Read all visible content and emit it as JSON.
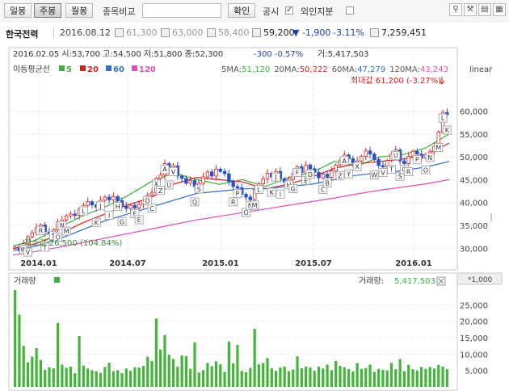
{
  "toolbar": {
    "tabs": [
      "일봉",
      "주봉",
      "월봉"
    ],
    "compare_label": "종목비교",
    "confirm_label": "확인",
    "disclosure_label": "공시",
    "foreign_label": "외인지분",
    "icons": [
      "magic-wand-icon",
      "tools-icon",
      "save-icon",
      "layout-icon"
    ]
  },
  "info": {
    "stock_name": "한국전력",
    "date": "2016.08.12",
    "open_icon": "시",
    "open": "61,300",
    "high_icon": "고",
    "high": "63,000",
    "low_icon": "저",
    "low": "58,400",
    "close_icon": "종",
    "close": "59,200",
    "change": "▼ -1,900",
    "change_pct": "-3.11%",
    "vol_icon": "거",
    "volume": "7,259,451"
  },
  "chart_header": {
    "line1": "2016.02.05  시:53,700  고:54,500  저:51,800  종:52,300",
    "chg": "-300  -0.57%",
    "vol": "거:5,417,503",
    "ma_title": "이동평균선",
    "ma_legend": [
      {
        "label": "5",
        "color": "#3cb23c"
      },
      {
        "label": "20",
        "color": "#d9201a"
      },
      {
        "label": "60",
        "color": "#2f6fd1"
      },
      {
        "label": "120",
        "color": "#e04fb5"
      }
    ],
    "ma_values": [
      {
        "label": "5MA:",
        "value": "51,120",
        "color": "#3cb23c"
      },
      {
        "label": "20MA:",
        "value": "50,222",
        "color": "#d9201a"
      },
      {
        "label": "60MA:",
        "value": "47,279",
        "color": "#2f6fd1"
      },
      {
        "label": "120MA:",
        "value": "43,243",
        "color": "#e04fb5"
      }
    ],
    "scale": "linear",
    "max_label": "최대값 61,200 (-3.27%)",
    "min_label": "최소값 26,500 (104.84%)"
  },
  "volume_header": {
    "title": "거래량",
    "label": "거래량:",
    "value": "5,417,503",
    "unit": "*1,000"
  },
  "chart_data": {
    "type": "candlestick",
    "x_ticks": [
      "2014.01",
      "2014.07",
      "2015.01",
      "2015.07",
      "2016.01"
    ],
    "price_ticks": [
      30000,
      35000,
      40000,
      45000,
      50000,
      55000,
      60000
    ],
    "price_range": [
      26000,
      64500
    ],
    "volume_ticks": [
      5000,
      10000,
      15000,
      20000,
      25000
    ],
    "volume_range": [
      0,
      30000
    ],
    "closes": [
      30200,
      29500,
      31000,
      32500,
      33400,
      34500,
      35100,
      33600,
      33200,
      34000,
      35800,
      36200,
      37100,
      37500,
      37200,
      38600,
      39400,
      40200,
      39500,
      39000,
      40500,
      41200,
      40600,
      41300,
      40400,
      39200,
      38700,
      39400,
      38800,
      39600,
      40500,
      41600,
      42100,
      45300,
      46000,
      48500,
      47200,
      48000,
      45800,
      45300,
      44200,
      44800,
      43500,
      44200,
      45600,
      46700,
      45800,
      47300,
      46800,
      46300,
      44600,
      43500,
      43200,
      41800,
      41200,
      40600,
      42800,
      44100,
      45200,
      46400,
      45600,
      46800,
      45200,
      44500,
      45100,
      46400,
      47800,
      46500,
      48200,
      47400,
      46600,
      45400,
      46200,
      45500,
      46900,
      48200,
      49200,
      50400,
      49600,
      48600,
      49100,
      50100,
      51300,
      50600,
      49400,
      48100,
      47800,
      49200,
      50600,
      51500,
      49100,
      48500,
      50100,
      51200,
      50600,
      49700,
      50500,
      51100,
      52300,
      55400,
      59700,
      59200
    ],
    "volumes": [
      29500,
      22000,
      12500,
      7500,
      9200,
      11800,
      8200,
      5200,
      6000,
      5700,
      19500,
      6800,
      5800,
      6200,
      4200,
      15500,
      6500,
      5600,
      5100,
      4800,
      4300,
      6100,
      7400,
      4800,
      5100,
      4200,
      5600,
      4900,
      6000,
      5900,
      6400,
      9200,
      7900,
      20800,
      11400,
      15800,
      9800,
      8500,
      6200,
      9600,
      9400,
      5500,
      13600,
      4400,
      5100,
      7300,
      6300,
      7800,
      6900,
      4600,
      13800,
      7200,
      12800,
      4900,
      4500,
      5800,
      17700,
      6900,
      7300,
      8800,
      5700,
      4900,
      5900,
      6200,
      4800,
      5300,
      9300,
      5700,
      6200,
      5900,
      4900,
      6200,
      5600,
      6800,
      5100,
      7900,
      6400,
      6000,
      5400,
      4700,
      7300,
      5500,
      5800,
      6800,
      4600,
      5500,
      5200,
      5000,
      7300,
      5400,
      8500,
      4800,
      6700,
      5400,
      5000,
      6100,
      5500,
      6100,
      5600,
      6700,
      6200,
      5400
    ],
    "ma_series": [
      {
        "name": "5",
        "color": "#3cb23c",
        "points": [
          30500,
          31800,
          34500,
          37000,
          39000,
          41500,
          44500,
          46500,
          45000,
          44000,
          45000,
          43500,
          45500,
          46500,
          49000,
          48000,
          50000,
          50500,
          52000,
          55000
        ]
      },
      {
        "name": "20",
        "color": "#d9201a",
        "points": [
          30000,
          31000,
          33000,
          35500,
          37500,
          39500,
          41000,
          44000,
          45500,
          45000,
          44500,
          43000,
          44000,
          45500,
          47500,
          48500,
          49000,
          49500,
          50500,
          53000
        ]
      },
      {
        "name": "60",
        "color": "#2f6fd1",
        "points": [
          29500,
          30500,
          32000,
          34000,
          36000,
          37500,
          39000,
          40500,
          42000,
          42500,
          43000,
          43000,
          43500,
          44000,
          45000,
          46000,
          46500,
          47000,
          47800,
          49000
        ]
      },
      {
        "name": "120",
        "color": "#e04fb5",
        "points": [
          28500,
          29300,
          30200,
          31200,
          32200,
          33200,
          34200,
          35200,
          36200,
          37000,
          37800,
          38600,
          39400,
          40200,
          41000,
          41900,
          42700,
          43400,
          44100,
          45000
        ]
      }
    ],
    "markers": [
      {
        "i": 2,
        "l": "W",
        "up": false
      },
      {
        "i": 3,
        "l": "V",
        "up": false
      },
      {
        "i": 6,
        "l": "R",
        "up": false
      },
      {
        "i": 7,
        "l": "T",
        "up": false
      },
      {
        "i": 9,
        "l": "S",
        "up": false
      },
      {
        "i": 10,
        "l": "O",
        "up": false
      },
      {
        "i": 11,
        "l": "N",
        "up": false
      },
      {
        "i": 12,
        "l": "M",
        "up": false
      },
      {
        "i": 16,
        "l": "L",
        "up": false
      },
      {
        "i": 19,
        "l": "K",
        "up": false
      },
      {
        "i": 20,
        "l": "J",
        "up": false
      },
      {
        "i": 22,
        "l": "I",
        "up": false
      },
      {
        "i": 24,
        "l": "H",
        "up": false
      },
      {
        "i": 25,
        "l": "G",
        "up": false
      },
      {
        "i": 28,
        "l": "F",
        "up": false
      },
      {
        "i": 29,
        "l": "E",
        "up": false
      },
      {
        "i": 31,
        "l": "D",
        "up": false
      },
      {
        "i": 32,
        "l": "C",
        "up": false
      },
      {
        "i": 33,
        "l": "X",
        "up": false
      },
      {
        "i": 34,
        "l": "Z",
        "up": false
      },
      {
        "i": 35,
        "l": "A",
        "up": false
      },
      {
        "i": 36,
        "l": "U",
        "up": false
      },
      {
        "i": 37,
        "l": "V",
        "up": false
      },
      {
        "i": 42,
        "l": "Q",
        "up": false
      },
      {
        "i": 43,
        "l": "S",
        "up": false
      },
      {
        "i": 51,
        "l": "R",
        "up": false
      },
      {
        "i": 52,
        "l": "P",
        "up": false
      },
      {
        "i": 54,
        "l": "O",
        "up": false
      },
      {
        "i": 55,
        "l": "N",
        "up": false
      },
      {
        "i": 56,
        "l": "M",
        "up": false
      },
      {
        "i": 57,
        "l": "L",
        "up": false
      },
      {
        "i": 60,
        "l": "K",
        "up": false
      },
      {
        "i": 61,
        "l": "J",
        "up": false
      },
      {
        "i": 62,
        "l": "I",
        "up": false
      },
      {
        "i": 64,
        "l": "H",
        "up": false
      },
      {
        "i": 65,
        "l": "G",
        "up": false
      },
      {
        "i": 66,
        "l": "F",
        "up": false
      },
      {
        "i": 68,
        "l": "E",
        "up": false
      },
      {
        "i": 69,
        "l": "D",
        "up": false
      },
      {
        "i": 72,
        "l": "C",
        "up": false
      },
      {
        "i": 73,
        "l": "B",
        "up": false
      },
      {
        "i": 76,
        "l": "Z",
        "up": false
      },
      {
        "i": 77,
        "l": "A",
        "up": false
      },
      {
        "i": 78,
        "l": "Y",
        "up": false
      },
      {
        "i": 80,
        "l": "X",
        "up": false
      },
      {
        "i": 84,
        "l": "W",
        "up": false
      },
      {
        "i": 86,
        "l": "V",
        "up": false
      },
      {
        "i": 88,
        "l": "T",
        "up": false
      },
      {
        "i": 89,
        "l": "U",
        "up": false
      },
      {
        "i": 90,
        "l": "S",
        "up": false
      },
      {
        "i": 91,
        "l": "Q",
        "up": false
      },
      {
        "i": 92,
        "l": "R",
        "up": false
      },
      {
        "i": 94,
        "l": "P",
        "up": false
      },
      {
        "i": 96,
        "l": "O",
        "up": false
      },
      {
        "i": 97,
        "l": "N",
        "up": false
      },
      {
        "i": 99,
        "l": "M",
        "up": false
      },
      {
        "i": 100,
        "l": "L",
        "up": false
      },
      {
        "i": 101,
        "l": "K",
        "up": false
      }
    ]
  }
}
